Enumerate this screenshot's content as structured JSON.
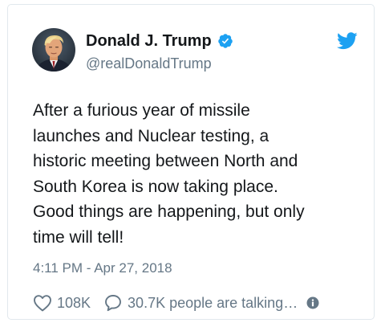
{
  "tweet": {
    "display_name": "Donald J. Trump",
    "handle": "@realDonaldTrump",
    "text": "After a furious year of missile\nlaunches and Nuclear testing, a\nhistoric meeting between North and\nSouth Korea is now taking place.\nGood things are happening, but only\ntime will tell!",
    "timestamp": "4:11 PM - Apr 27, 2018",
    "like_count": "108K",
    "talk_text": "30.7K people are talking…"
  },
  "icons": {
    "verified": "verified-badge-icon",
    "brand": "twitter-bird-icon",
    "like": "heart-icon",
    "reply": "speech-bubble-icon",
    "info": "info-icon"
  },
  "colors": {
    "brand_blue": "#1da1f2",
    "text_primary": "#14171a",
    "text_secondary": "#657786",
    "border": "#e1e8ed"
  }
}
